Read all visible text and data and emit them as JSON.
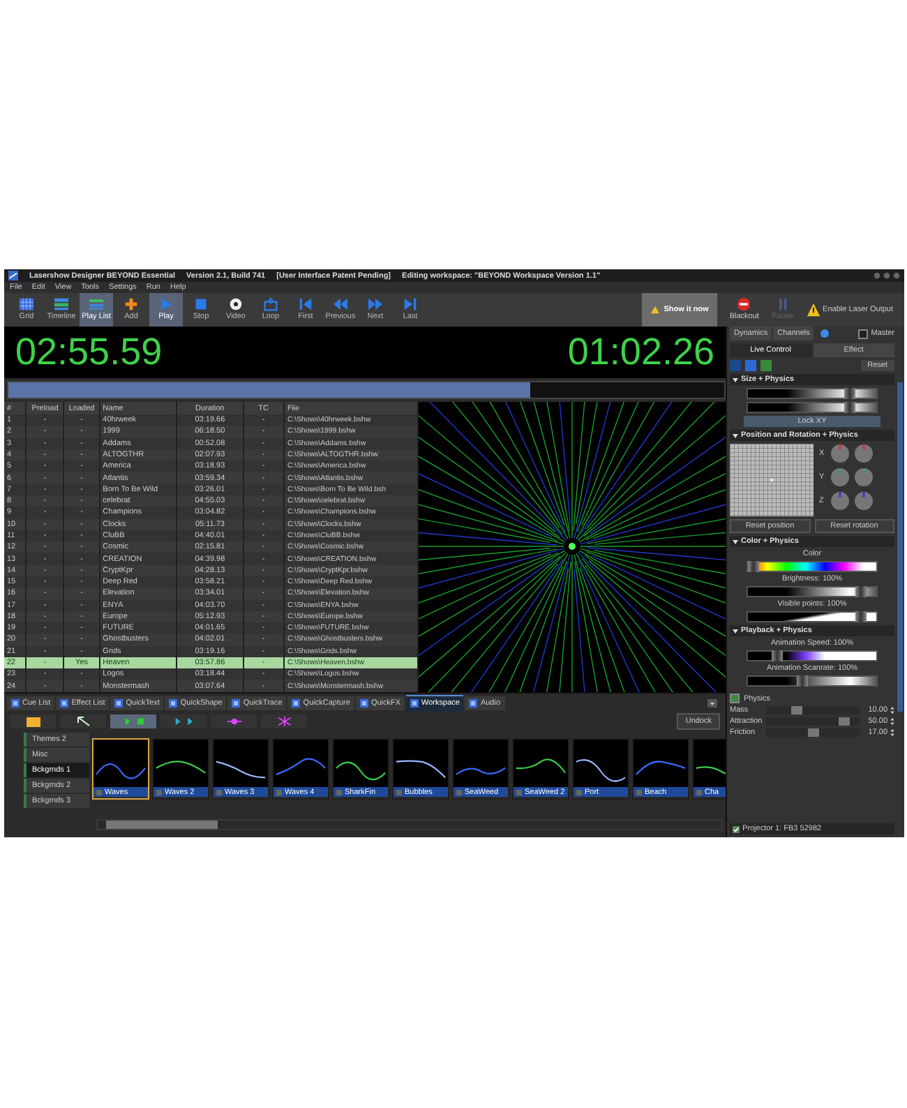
{
  "window": {
    "title_parts": [
      "Lasershow Designer BEYOND Essential",
      "Version 2.1, Build 741",
      "[User Interface Patent Pending]",
      "Editing workspace: \"BEYOND Workspace Version 1.1\""
    ]
  },
  "menu": [
    "File",
    "Edit",
    "View",
    "Tools",
    "Settings",
    "Run",
    "Help"
  ],
  "toolbar": [
    {
      "label": "Grid",
      "kind": "grid",
      "selected": false
    },
    {
      "label": "Timeline",
      "kind": "timeline",
      "selected": false
    },
    {
      "label": "Play List",
      "kind": "playlist",
      "selected": true
    },
    {
      "label": "Add",
      "kind": "add",
      "selected": false
    },
    {
      "label": "Play",
      "kind": "play",
      "selected": true
    },
    {
      "label": "Stop",
      "kind": "stop",
      "selected": false
    },
    {
      "label": "Video",
      "kind": "video",
      "selected": false
    },
    {
      "label": "Loop",
      "kind": "loop",
      "selected": false
    },
    {
      "label": "First",
      "kind": "first",
      "selected": false
    },
    {
      "label": "Previous",
      "kind": "previous",
      "selected": false
    },
    {
      "label": "Next",
      "kind": "next",
      "selected": false
    },
    {
      "label": "Last",
      "kind": "last",
      "selected": false
    }
  ],
  "show_button": "Show it now",
  "output_buttons": [
    {
      "label": "Blackout",
      "kind": "blackout",
      "disabled": false
    },
    {
      "label": "Pause",
      "kind": "pause",
      "disabled": true
    },
    {
      "label": "Enable Laser Output",
      "kind": "warning",
      "disabled": false
    }
  ],
  "timers": {
    "elapsed": "02:55.59",
    "remaining": "01:02.26"
  },
  "progress": {
    "level": 0.73
  },
  "table": {
    "columns": [
      "#",
      "Preload",
      "Loaded",
      "Name",
      "Duration",
      "TC",
      "File"
    ],
    "rows": [
      {
        "n": "1",
        "preload": "-",
        "loaded": "-",
        "name": "40hrweek",
        "duration": "03:19.66",
        "tc": "-",
        "file": "C:\\Shows\\40hrweek.bshw",
        "selected": false
      },
      {
        "n": "2",
        "preload": "-",
        "loaded": "-",
        "name": "1999",
        "duration": "06:18.50",
        "tc": "-",
        "file": "C:\\Shows\\1999.bshw",
        "selected": false
      },
      {
        "n": "3",
        "preload": "-",
        "loaded": "-",
        "name": "Addams",
        "duration": "00:52.08",
        "tc": "-",
        "file": "C:\\Shows\\Addams.bshw",
        "selected": false
      },
      {
        "n": "4",
        "preload": "-",
        "loaded": "-",
        "name": "ALTOGTHR",
        "duration": "02:07.93",
        "tc": "-",
        "file": "C:\\Shows\\ALTOGTHR.bshw",
        "selected": false
      },
      {
        "n": "5",
        "preload": "-",
        "loaded": "-",
        "name": "America",
        "duration": "03:18.93",
        "tc": "-",
        "file": "C:\\Shows\\America.bshw",
        "selected": false
      },
      {
        "n": "6",
        "preload": "-",
        "loaded": "-",
        "name": "Atlantis",
        "duration": "03:59.34",
        "tc": "-",
        "file": "C:\\Shows\\Atlantis.bshw",
        "selected": false
      },
      {
        "n": "7",
        "preload": "-",
        "loaded": "-",
        "name": "Born To Be Wild",
        "duration": "03:26.01",
        "tc": "-",
        "file": "C:\\Shows\\Born To Be Wild.bsh",
        "selected": false
      },
      {
        "n": "8",
        "preload": "-",
        "loaded": "-",
        "name": "celebrat",
        "duration": "04:55.03",
        "tc": "-",
        "file": "C:\\Shows\\celebrat.bshw",
        "selected": false
      },
      {
        "n": "9",
        "preload": "-",
        "loaded": "-",
        "name": "Champions",
        "duration": "03:04.82",
        "tc": "-",
        "file": "C:\\Shows\\Champions.bshw",
        "selected": false
      },
      {
        "n": "10",
        "preload": "-",
        "loaded": "-",
        "name": "Clocks",
        "duration": "05:11.73",
        "tc": "-",
        "file": "C:\\Shows\\Clocks.bshw",
        "selected": false
      },
      {
        "n": "11",
        "preload": "-",
        "loaded": "-",
        "name": "CluBB",
        "duration": "04:40.01",
        "tc": "-",
        "file": "C:\\Shows\\CluBB.bshw",
        "selected": false
      },
      {
        "n": "12",
        "preload": "-",
        "loaded": "-",
        "name": "Cosmic",
        "duration": "02:15.81",
        "tc": "-",
        "file": "C:\\Shows\\Cosmic.bshw",
        "selected": false
      },
      {
        "n": "13",
        "preload": "-",
        "loaded": "-",
        "name": "CREATION",
        "duration": "04:39.98",
        "tc": "-",
        "file": "C:\\Shows\\CREATION.bshw",
        "selected": false
      },
      {
        "n": "14",
        "preload": "-",
        "loaded": "-",
        "name": "CryptKpr",
        "duration": "04:28.13",
        "tc": "-",
        "file": "C:\\Shows\\CryptKpr.bshw",
        "selected": false
      },
      {
        "n": "15",
        "preload": "-",
        "loaded": "-",
        "name": "Deep Red",
        "duration": "03:58.21",
        "tc": "-",
        "file": "C:\\Shows\\Deep Red.bshw",
        "selected": false
      },
      {
        "n": "16",
        "preload": "-",
        "loaded": "-",
        "name": "Elevation",
        "duration": "03:34.01",
        "tc": "-",
        "file": "C:\\Shows\\Elevation.bshw",
        "selected": false
      },
      {
        "n": "17",
        "preload": "-",
        "loaded": "-",
        "name": "ENYA",
        "duration": "04:03.70",
        "tc": "-",
        "file": "C:\\Shows\\ENYA.bshw",
        "selected": false
      },
      {
        "n": "18",
        "preload": "-",
        "loaded": "-",
        "name": "Europe",
        "duration": "05:12.93",
        "tc": "-",
        "file": "C:\\Shows\\Europe.bshw",
        "selected": false
      },
      {
        "n": "19",
        "preload": "-",
        "loaded": "-",
        "name": "FUTURE",
        "duration": "04:01.65",
        "tc": "-",
        "file": "C:\\Shows\\FUTURE.bshw",
        "selected": false
      },
      {
        "n": "20",
        "preload": "-",
        "loaded": "-",
        "name": "Ghostbusters",
        "duration": "04:02.01",
        "tc": "-",
        "file": "C:\\Shows\\Ghostbusters.bshw",
        "selected": false
      },
      {
        "n": "21",
        "preload": "-",
        "loaded": "-",
        "name": "Grids",
        "duration": "03:19.16",
        "tc": "-",
        "file": "C:\\Shows\\Grids.bshw",
        "selected": false
      },
      {
        "n": "22",
        "preload": "-",
        "loaded": "Yes",
        "name": "Heaven",
        "duration": "03:57.86",
        "tc": "-",
        "file": "C:\\Shows\\Heaven.bshw",
        "selected": true
      },
      {
        "n": "23",
        "preload": "-",
        "loaded": "-",
        "name": "Logos",
        "duration": "03:18.44",
        "tc": "-",
        "file": "C:\\Shows\\Logos.bshw",
        "selected": false
      },
      {
        "n": "24",
        "preload": "-",
        "loaded": "-",
        "name": "Monstermash",
        "duration": "03:07.64",
        "tc": "-",
        "file": "C:\\Shows\\Monstermash.bshw",
        "selected": false
      }
    ]
  },
  "bottom_tabs": [
    {
      "label": "Cue List",
      "selected": false
    },
    {
      "label": "Effect List",
      "selected": false
    },
    {
      "label": "QuickText",
      "selected": false
    },
    {
      "label": "QuickShape",
      "selected": false
    },
    {
      "label": "QuickTrace",
      "selected": false
    },
    {
      "label": "QuickCapture",
      "selected": false
    },
    {
      "label": "QuickFX",
      "selected": false
    },
    {
      "label": "Workspace",
      "selected": true
    },
    {
      "label": "Audio",
      "selected": false
    }
  ],
  "undock_button": "Undock",
  "categories": [
    {
      "label": "Themes 2",
      "selected": false
    },
    {
      "label": "Misc",
      "selected": false
    },
    {
      "label": "Bckgrnds 1",
      "selected": true
    },
    {
      "label": "Bckgrnds 2",
      "selected": false
    },
    {
      "label": "Bckgrnds 3",
      "selected": false
    }
  ],
  "cues": [
    {
      "label": "Waves",
      "selected": true
    },
    {
      "label": "Waves 2",
      "selected": false
    },
    {
      "label": "Waves 3",
      "selected": false
    },
    {
      "label": "Waves 4",
      "selected": false
    },
    {
      "label": "SharkFin",
      "selected": false
    },
    {
      "label": "Bubbles",
      "selected": false
    },
    {
      "label": "SeaWeed",
      "selected": false
    },
    {
      "label": "SeaWeed 2",
      "selected": false
    },
    {
      "label": "Port",
      "selected": false
    },
    {
      "label": "Beach",
      "selected": false
    },
    {
      "label": "Cha",
      "selected": false
    }
  ],
  "panel": {
    "tabs": [
      {
        "label": "Dynamics",
        "selected": false
      },
      {
        "label": "Channels",
        "selected": false
      }
    ],
    "master": {
      "label": "Master",
      "checked": false
    },
    "subtabs": [
      {
        "label": "Live Control",
        "selected": true
      },
      {
        "label": "Effect",
        "selected": false
      }
    ],
    "reset_button": "Reset",
    "size_section": {
      "title": "Size + Physics",
      "expanded": true,
      "sliders": [
        {
          "kind": "gradient",
          "level": 0.82
        },
        {
          "kind": "gradient",
          "level": 0.82
        }
      ],
      "lock_button": "Lock XY"
    },
    "position_section": {
      "title": "Position and Rotation + Physics",
      "expanded": true,
      "axes": [
        {
          "label": "X",
          "color": "#c83c3c"
        },
        {
          "label": "Y",
          "color": "#3c9c5c"
        },
        {
          "label": "Z",
          "color": "#3c3cc8"
        }
      ],
      "buttons": [
        "Reset position",
        "Reset rotation"
      ]
    },
    "color_section": {
      "title": "Color + Physics",
      "expanded": true,
      "sliders": [
        {
          "label": "Color",
          "kind": "spectrum",
          "level": 0.0
        },
        {
          "label": "Brightness: 100%",
          "kind": "gradient",
          "level": 0.92
        },
        {
          "label": "Visible points: 100%",
          "kind": "ramp",
          "level": 0.92
        }
      ]
    },
    "playback_section": {
      "title": "Playback + Physics",
      "expanded": true,
      "sliders": [
        {
          "label": "Animation Speed: 100%",
          "kind": "speed",
          "level": 0.2
        },
        {
          "label": "Animation Scanrate: 100%",
          "kind": "gradient",
          "level": 0.42
        }
      ]
    },
    "physics": {
      "label": "Physics",
      "checked": true,
      "rows": [
        {
          "label": "Mass",
          "value": "10.00",
          "level": 0.3
        },
        {
          "label": "Attraction",
          "value": "50.00",
          "level": 0.88
        },
        {
          "label": "Friction",
          "value": "17.00",
          "level": 0.5
        }
      ]
    },
    "status": "Projector 1: FB3 52982"
  }
}
